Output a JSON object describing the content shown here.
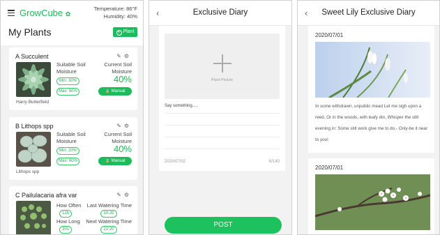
{
  "screen1": {
    "brand": "GrowCube",
    "temperature": "Temperature: 86°F",
    "humidity": "Humidity: 40%",
    "title": "My Plants",
    "add_button": "Plant",
    "plants": [
      {
        "name": "A Succulent",
        "left_label": "Suitable Soil Moisture",
        "right_label": "Current Soil Moisture",
        "min": "Min: 30%",
        "max": "Max: 50%",
        "value": "40%",
        "button": "Manual",
        "caption": "Harry Butterfield"
      },
      {
        "name": "B Lithops spp",
        "left_label": "Suitable Soil Moisture",
        "right_label": "Current Soil Moisture",
        "min": "Min: 20%",
        "max": "Max: 60%",
        "value": "40%",
        "button": "Manual",
        "caption": "Lithops spp"
      },
      {
        "name": "C Pailulacaria afra var",
        "how_often_label": "How Often",
        "how_often": "12h",
        "last_label": "Last Watering Time",
        "last": "10:20",
        "how_long_label": "How Long",
        "how_long": "30s",
        "next_label": "Next Watering Time",
        "next": "22:20"
      }
    ]
  },
  "screen2": {
    "back": "‹",
    "title": "Exclusive Diary",
    "photo_caption": "Plant Picture",
    "placeholder": "Say something.....",
    "date": "2020/07/02",
    "count": "6/140",
    "post_button": "POST"
  },
  "screen3": {
    "back": "‹",
    "title": "Sweet Lily Exclusive Diary",
    "entries": [
      {
        "date": "2020/07/01",
        "text": "In some withdrawn, unpublic mead Let me sigh upon a reed, Or in the woods, with leafy din, Whisper the still evening in: Some still work give me to do,- Only-be it near to you!"
      },
      {
        "date": "2020/07/01",
        "text": ""
      }
    ]
  },
  "colors": {
    "accent": "#1dbb5b",
    "background": "#f2f2f2"
  },
  "icons": [
    "menu-icon",
    "leaf-icon",
    "plus-circle-icon",
    "edit-icon",
    "gear-icon",
    "water-icon",
    "back-chevron-icon",
    "plus-icon"
  ]
}
